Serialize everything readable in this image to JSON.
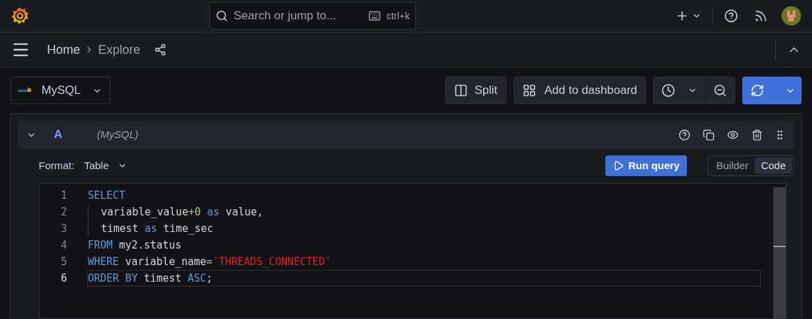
{
  "search": {
    "placeholder": "Search or jump to...",
    "shortcut": "ctrl+k"
  },
  "breadcrumbs": [
    {
      "label": "Home",
      "current": false
    },
    {
      "label": "Explore",
      "current": true
    }
  ],
  "datasource": {
    "name": "MySQL"
  },
  "toolbar": {
    "split": "Split",
    "add_to_dashboard": "Add to dashboard"
  },
  "query": {
    "ref": "A",
    "datasource": "(MySQL)",
    "expanded": true,
    "format_label": "Format:",
    "format_value": "Table",
    "run": "Run query",
    "modes": [
      {
        "label": "Builder",
        "selected": false
      },
      {
        "label": "Code",
        "selected": true
      }
    ]
  },
  "editor": {
    "lines": [
      {
        "number": "1",
        "indented": false,
        "active": false,
        "tokens": [
          {
            "text": "SELECT",
            "kind": "keyword"
          }
        ]
      },
      {
        "number": "2",
        "indented": true,
        "active": false,
        "tokens": [
          {
            "text": "variable_value",
            "kind": "plain"
          },
          {
            "text": "+0",
            "kind": "number"
          },
          {
            "text": " as",
            "kind": "keyword"
          },
          {
            "text": " value,",
            "kind": "plain"
          }
        ]
      },
      {
        "number": "3",
        "indented": true,
        "active": false,
        "tokens": [
          {
            "text": "timest",
            "kind": "plain"
          },
          {
            "text": " as",
            "kind": "keyword"
          },
          {
            "text": " time_sec",
            "kind": "plain"
          }
        ]
      },
      {
        "number": "4",
        "indented": false,
        "active": false,
        "tokens": [
          {
            "text": "FROM",
            "kind": "keyword"
          },
          {
            "text": " my2.status",
            "kind": "plain"
          }
        ]
      },
      {
        "number": "5",
        "indented": false,
        "active": false,
        "tokens": [
          {
            "text": "WHERE",
            "kind": "keyword"
          },
          {
            "text": " variable_name",
            "kind": "plain"
          },
          {
            "text": "=",
            "kind": "number"
          },
          {
            "text": "'THREADS_CONNECTED'",
            "kind": "string"
          }
        ]
      },
      {
        "number": "6",
        "indented": false,
        "active": true,
        "tokens": [
          {
            "text": "ORDER BY",
            "kind": "keyword"
          },
          {
            "text": " timest",
            "kind": "plain"
          },
          {
            "text": " ASC",
            "kind": "keyword"
          },
          {
            "text": ";",
            "kind": "plain"
          }
        ]
      }
    ]
  }
}
